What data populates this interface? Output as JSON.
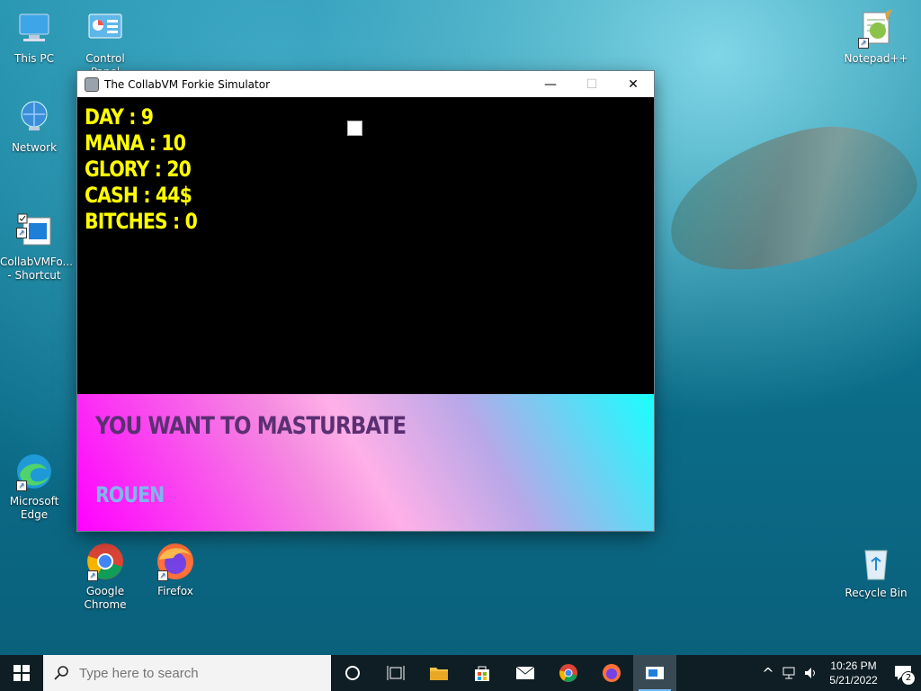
{
  "desktop": {
    "icons": [
      {
        "label": "This PC"
      },
      {
        "label": "Control Panel"
      },
      {
        "label": "Network"
      },
      {
        "label": "CollabVMFo...\n- Shortcut"
      },
      {
        "label": "Microsoft Edge"
      },
      {
        "label": "Google Chrome"
      },
      {
        "label": "Firefox"
      },
      {
        "label": "Notepad++"
      },
      {
        "label": "Recycle Bin"
      }
    ]
  },
  "window": {
    "title": "The CollabVM Forkie Simulator",
    "controls": {
      "minimize": "—",
      "maximize": "☐",
      "close": "✕"
    }
  },
  "game": {
    "stats": [
      "DAY : 9",
      "MANA : 10",
      "GLORY : 20",
      "CASH : 44$",
      "BITCHES : 0"
    ],
    "question": "YOU WANT TO MASTURBATE",
    "answer": "ROUEN"
  },
  "taskbar": {
    "search_placeholder": "Type here to search",
    "time": "10:26 PM",
    "date": "5/21/2022",
    "notification_count": "2"
  },
  "colors": {
    "stat_text": "#ffff00",
    "question_text": "#5b3073",
    "answer_text": "#7fb6ee",
    "taskbar": "#0f1e24"
  }
}
